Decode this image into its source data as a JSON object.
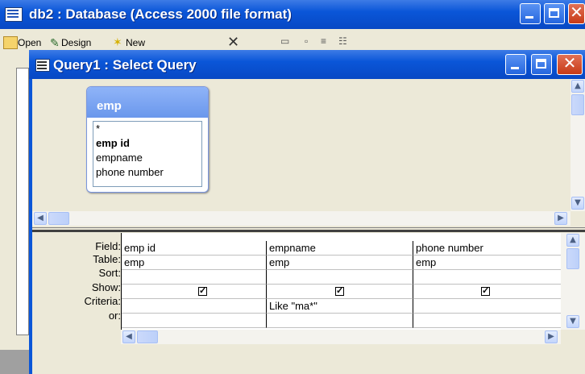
{
  "outer_window": {
    "title": "db2 : Database (Access 2000 file format)",
    "toolbar": {
      "open": "Open",
      "design": "Design",
      "new": "New"
    }
  },
  "query_window": {
    "title": "Query1 : Select Query"
  },
  "table_box": {
    "name": "emp",
    "fields": [
      "*",
      "emp id",
      "empname",
      "phone number"
    ]
  },
  "grid": {
    "row_labels": [
      "Field:",
      "Table:",
      "Sort:",
      "Show:",
      "Criteria:",
      "or:"
    ],
    "columns": [
      {
        "field": "emp id",
        "table": "emp",
        "sort": "",
        "show": true,
        "criteria": "",
        "or": ""
      },
      {
        "field": "empname",
        "table": "emp",
        "sort": "",
        "show": true,
        "criteria": "Like \"ma*\"",
        "or": ""
      },
      {
        "field": "phone number",
        "table": "emp",
        "sort": "",
        "show": true,
        "criteria": "",
        "or": ""
      }
    ]
  },
  "colors": {
    "title_blue": "#0a56d8",
    "close_red": "#c73a16",
    "table_header": "#7aa3f2"
  }
}
